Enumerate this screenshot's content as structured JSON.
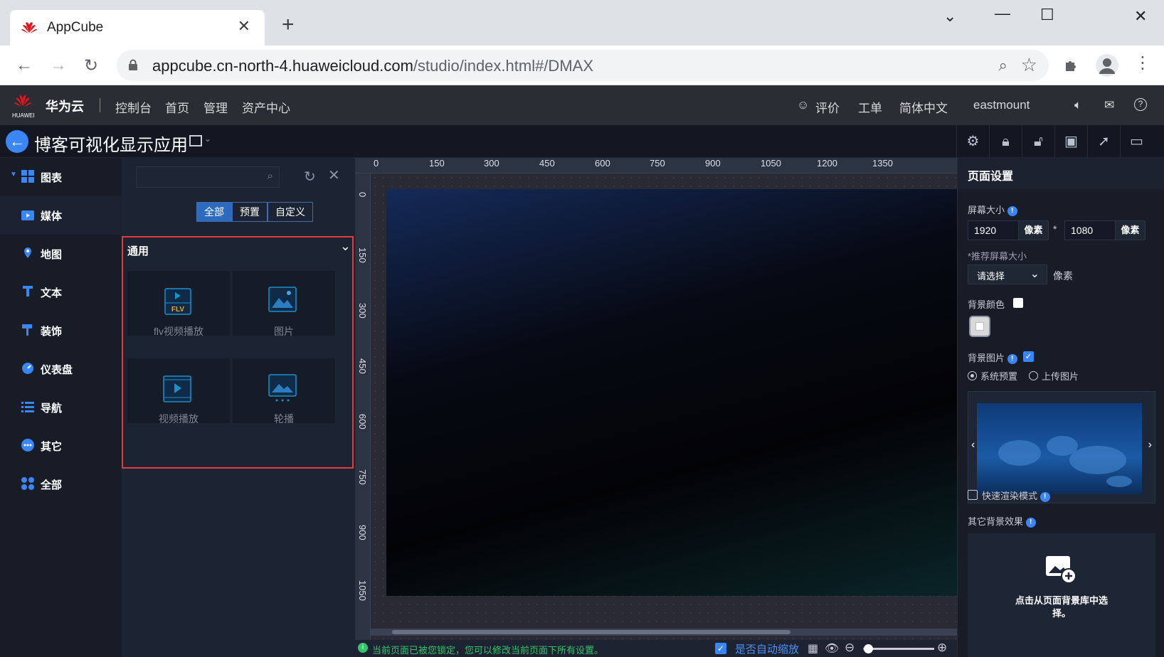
{
  "browser": {
    "tab_title": "AppCube",
    "new_tab": "+",
    "url_host": "appcube.cn-north-4.huaweicloud.com",
    "url_path": "/studio/index.html#/DMAX",
    "win_min": "—",
    "win_max": "☐",
    "win_close": "✕",
    "dropdown": "⌄"
  },
  "huawei_bar": {
    "logo_text": "HUAWEI",
    "brand": "华为云",
    "nav": [
      "控制台",
      "首页",
      "管理",
      "资产中心"
    ],
    "rate": "评价",
    "ticket": "工单",
    "language": "简体中文",
    "user": "eastmount"
  },
  "app": {
    "title": "博客可视化显示应用"
  },
  "left_nav": {
    "items": [
      {
        "label": "图表",
        "icon": "grid-icon"
      },
      {
        "label": "媒体",
        "icon": "media-icon"
      },
      {
        "label": "地图",
        "icon": "map-pin-icon"
      },
      {
        "label": "文本",
        "icon": "text-icon"
      },
      {
        "label": "装饰",
        "icon": "brush-icon"
      },
      {
        "label": "仪表盘",
        "icon": "gauge-icon"
      },
      {
        "label": "导航",
        "icon": "list-icon"
      },
      {
        "label": "其它",
        "icon": "more-icon"
      },
      {
        "label": "全部",
        "icon": "apps-icon"
      }
    ]
  },
  "panel": {
    "segments": [
      "全部",
      "预置",
      "自定义"
    ],
    "group_title": "通用",
    "cards": [
      {
        "label": "flv视频播放",
        "badge": "FLV"
      },
      {
        "label": "图片"
      },
      {
        "label": "视频播放"
      },
      {
        "label": "轮播"
      }
    ]
  },
  "ruler": {
    "top": [
      "0",
      "150",
      "300",
      "450",
      "600",
      "750",
      "900",
      "1050",
      "1200",
      "1350"
    ],
    "left": [
      "0",
      "150",
      "300",
      "450",
      "600",
      "750",
      "900",
      "1050"
    ]
  },
  "status": {
    "message": "当前页面已被您锁定，您可以修改当前页面下所有设置。",
    "auto_zoom": "是否自动缩放",
    "zoom_level": 0.07
  },
  "settings": {
    "title": "页面设置",
    "screen_size_label": "屏幕大小",
    "width": "1920",
    "height": "1080",
    "unit": "像素",
    "times": "*",
    "recommended_label": "*推荐屏幕大小",
    "recommended_placeholder": "请选择",
    "recommended_unit": "像素",
    "bg_color_label": "背景颜色",
    "bg_image_label": "背景图片",
    "bg_image_checked": true,
    "radio_system": "系统预置",
    "radio_upload": "上传图片",
    "fast_render_label": "快速渲染模式",
    "other_bg_label": "其它背景效果",
    "select_from_library": "点击从页面背景库中选择。"
  },
  "colors": {
    "accent": "#3b86f5",
    "highlight_border": "#e33b3b",
    "status_green": "#36c36b"
  }
}
